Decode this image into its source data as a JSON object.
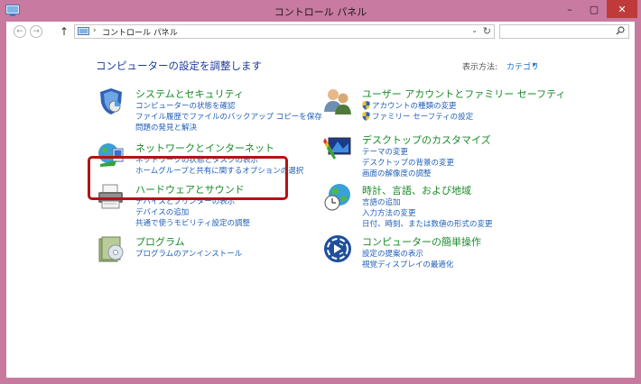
{
  "window": {
    "title": "コントロール パネル",
    "buttons": {
      "minimize": "–",
      "maximize": "▢",
      "close": "✕"
    }
  },
  "nav": {
    "back": "←",
    "forward": "→",
    "up": "↑",
    "address_chevron": "›",
    "address_text": "コントロール パネル",
    "address_chevron2": "›",
    "dropdown": "⌄",
    "refresh": "↻",
    "search_placeholder": ""
  },
  "main": {
    "heading": "コンピューターの設定を調整します",
    "view_by_label": "表示方法:",
    "view_by_value": "カテゴリ",
    "view_by_arrow": "▾"
  },
  "categories": [
    {
      "title": "システムとセキュリティ",
      "links": [
        "コンピューターの状態を確認",
        "ファイル履歴でファイルのバックアップ コピーを保存",
        "問題の発見と解決"
      ]
    },
    {
      "title": "ネットワークとインターネット",
      "links": [
        "ネットワークの状態とタスクの表示",
        "ホームグループと共有に関するオプションの選択"
      ]
    },
    {
      "title": "ハードウェアとサウンド",
      "links": [
        "デバイスとプリンターの表示",
        "デバイスの追加",
        "共通で使うモビリティ設定の調整"
      ]
    },
    {
      "title": "プログラム",
      "links": [
        "プログラムのアンインストール"
      ]
    },
    {
      "title": "ユーザー アカウントとファミリー セーフティ",
      "links": [
        "アカウントの種類の変更",
        "ファミリー セーフティの設定"
      ]
    },
    {
      "title": "デスクトップのカスタマイズ",
      "links": [
        "テーマの変更",
        "デスクトップの背景の変更",
        "画面の解像度の調整"
      ]
    },
    {
      "title": "時計、言語、および地域",
      "links": [
        "言語の追加",
        "入力方法の変更",
        "日付、時刻、または数値の形式の変更"
      ]
    },
    {
      "title": "コンピューターの簡単操作",
      "links": [
        "設定の提案の表示",
        "視覚ディスプレイの最適化"
      ]
    }
  ],
  "colors": {
    "accent_link": "#1f5fb8",
    "category_title": "#1a8a2a",
    "heading": "#1f3a9c",
    "highlight": "#b31313"
  }
}
